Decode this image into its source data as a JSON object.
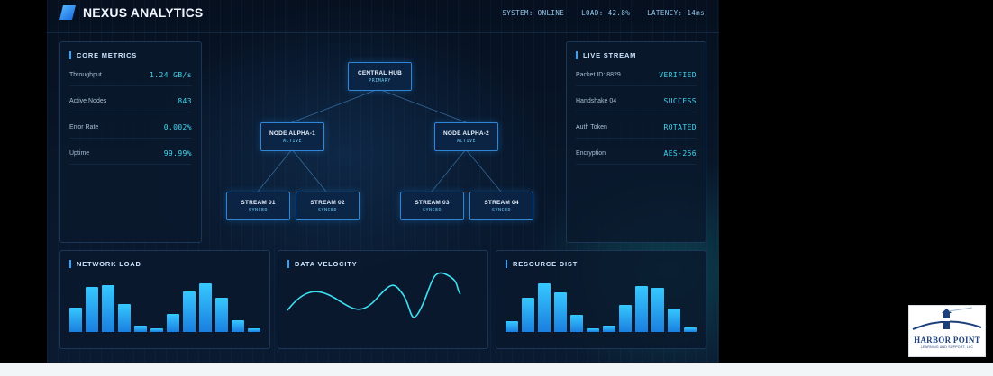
{
  "header": {
    "app_title": "NEXUS ANALYTICS",
    "status": {
      "system": "SYSTEM: ONLINE",
      "load": "LOAD: 42.8%",
      "latency": "LATENCY: 14ms"
    }
  },
  "core_metrics": {
    "title": "CORE METRICS",
    "rows": [
      {
        "label": "Throughput",
        "value": "1.24 GB/s"
      },
      {
        "label": "Active Nodes",
        "value": "843"
      },
      {
        "label": "Error Rate",
        "value": "0.002%"
      },
      {
        "label": "Uptime",
        "value": "99.99%"
      }
    ]
  },
  "live_stream": {
    "title": "LIVE STREAM",
    "rows": [
      {
        "label": "Packet ID: 8829",
        "value": "VERIFIED"
      },
      {
        "label": "Handshake 04",
        "value": "SUCCESS"
      },
      {
        "label": "Auth Token",
        "value": "ROTATED"
      },
      {
        "label": "Encryption",
        "value": "AES-256"
      }
    ]
  },
  "topology": {
    "hub": {
      "title": "CENTRAL HUB",
      "status": "PRIMARY"
    },
    "nodes": [
      {
        "title": "NODE ALPHA-1",
        "status": "ACTIVE"
      },
      {
        "title": "NODE ALPHA-2",
        "status": "ACTIVE"
      }
    ],
    "streams": [
      {
        "title": "STREAM 01",
        "status": "SYNCED"
      },
      {
        "title": "STREAM 02",
        "status": "SYNCED"
      },
      {
        "title": "STREAM 03",
        "status": "SYNCED"
      },
      {
        "title": "STREAM 04",
        "status": "SYNCED"
      }
    ]
  },
  "network_load": {
    "title": "NETWORK LOAD",
    "values": [
      27,
      50,
      52,
      31,
      7,
      4,
      20,
      45,
      54,
      38,
      13,
      4
    ]
  },
  "data_velocity": {
    "title": "DATA VELOCITY"
  },
  "resource_dist": {
    "title": "RESOURCE DIST",
    "values": [
      12,
      38,
      54,
      44,
      19,
      4,
      7,
      30,
      51,
      49,
      26,
      5
    ]
  },
  "watermark": {
    "text": "HARBOR POINT",
    "subtext": "LEARNING AND SUPPORT, LLC"
  },
  "colors": {
    "accent": "#2ea6ff",
    "value_cyan": "#41d6ef",
    "background": "#081629"
  }
}
